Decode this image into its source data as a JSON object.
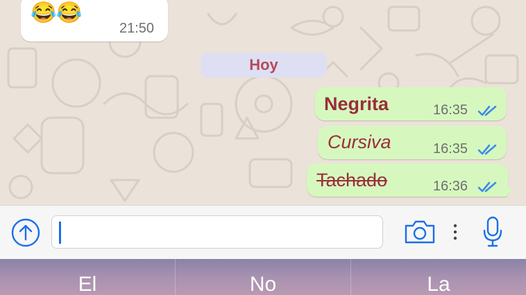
{
  "incoming": {
    "emojis": "😂😂",
    "time": "21:50"
  },
  "date_separator": "Hoy",
  "messages": [
    {
      "text": "Negrita",
      "style": "bold",
      "time": "16:35",
      "status": "read"
    },
    {
      "text": "Cursiva",
      "style": "italic",
      "time": "16:35",
      "status": "read"
    },
    {
      "text": "Tachado",
      "style": "strikethrough",
      "time": "16:36",
      "status": "read"
    }
  ],
  "composer": {
    "value": "",
    "placeholder": ""
  },
  "icons": {
    "attach": "upload-circle-icon",
    "camera": "camera-icon",
    "more": "more-vertical-icon",
    "mic": "microphone-icon",
    "ticks": "double-check-icon"
  },
  "suggestions": [
    "El",
    "No",
    "La"
  ],
  "colors": {
    "outgoing_bubble": "#d6f8bf",
    "message_text": "#9a2e3a",
    "read_ticks": "#3b8be8",
    "accent": "#1a6fe8"
  }
}
